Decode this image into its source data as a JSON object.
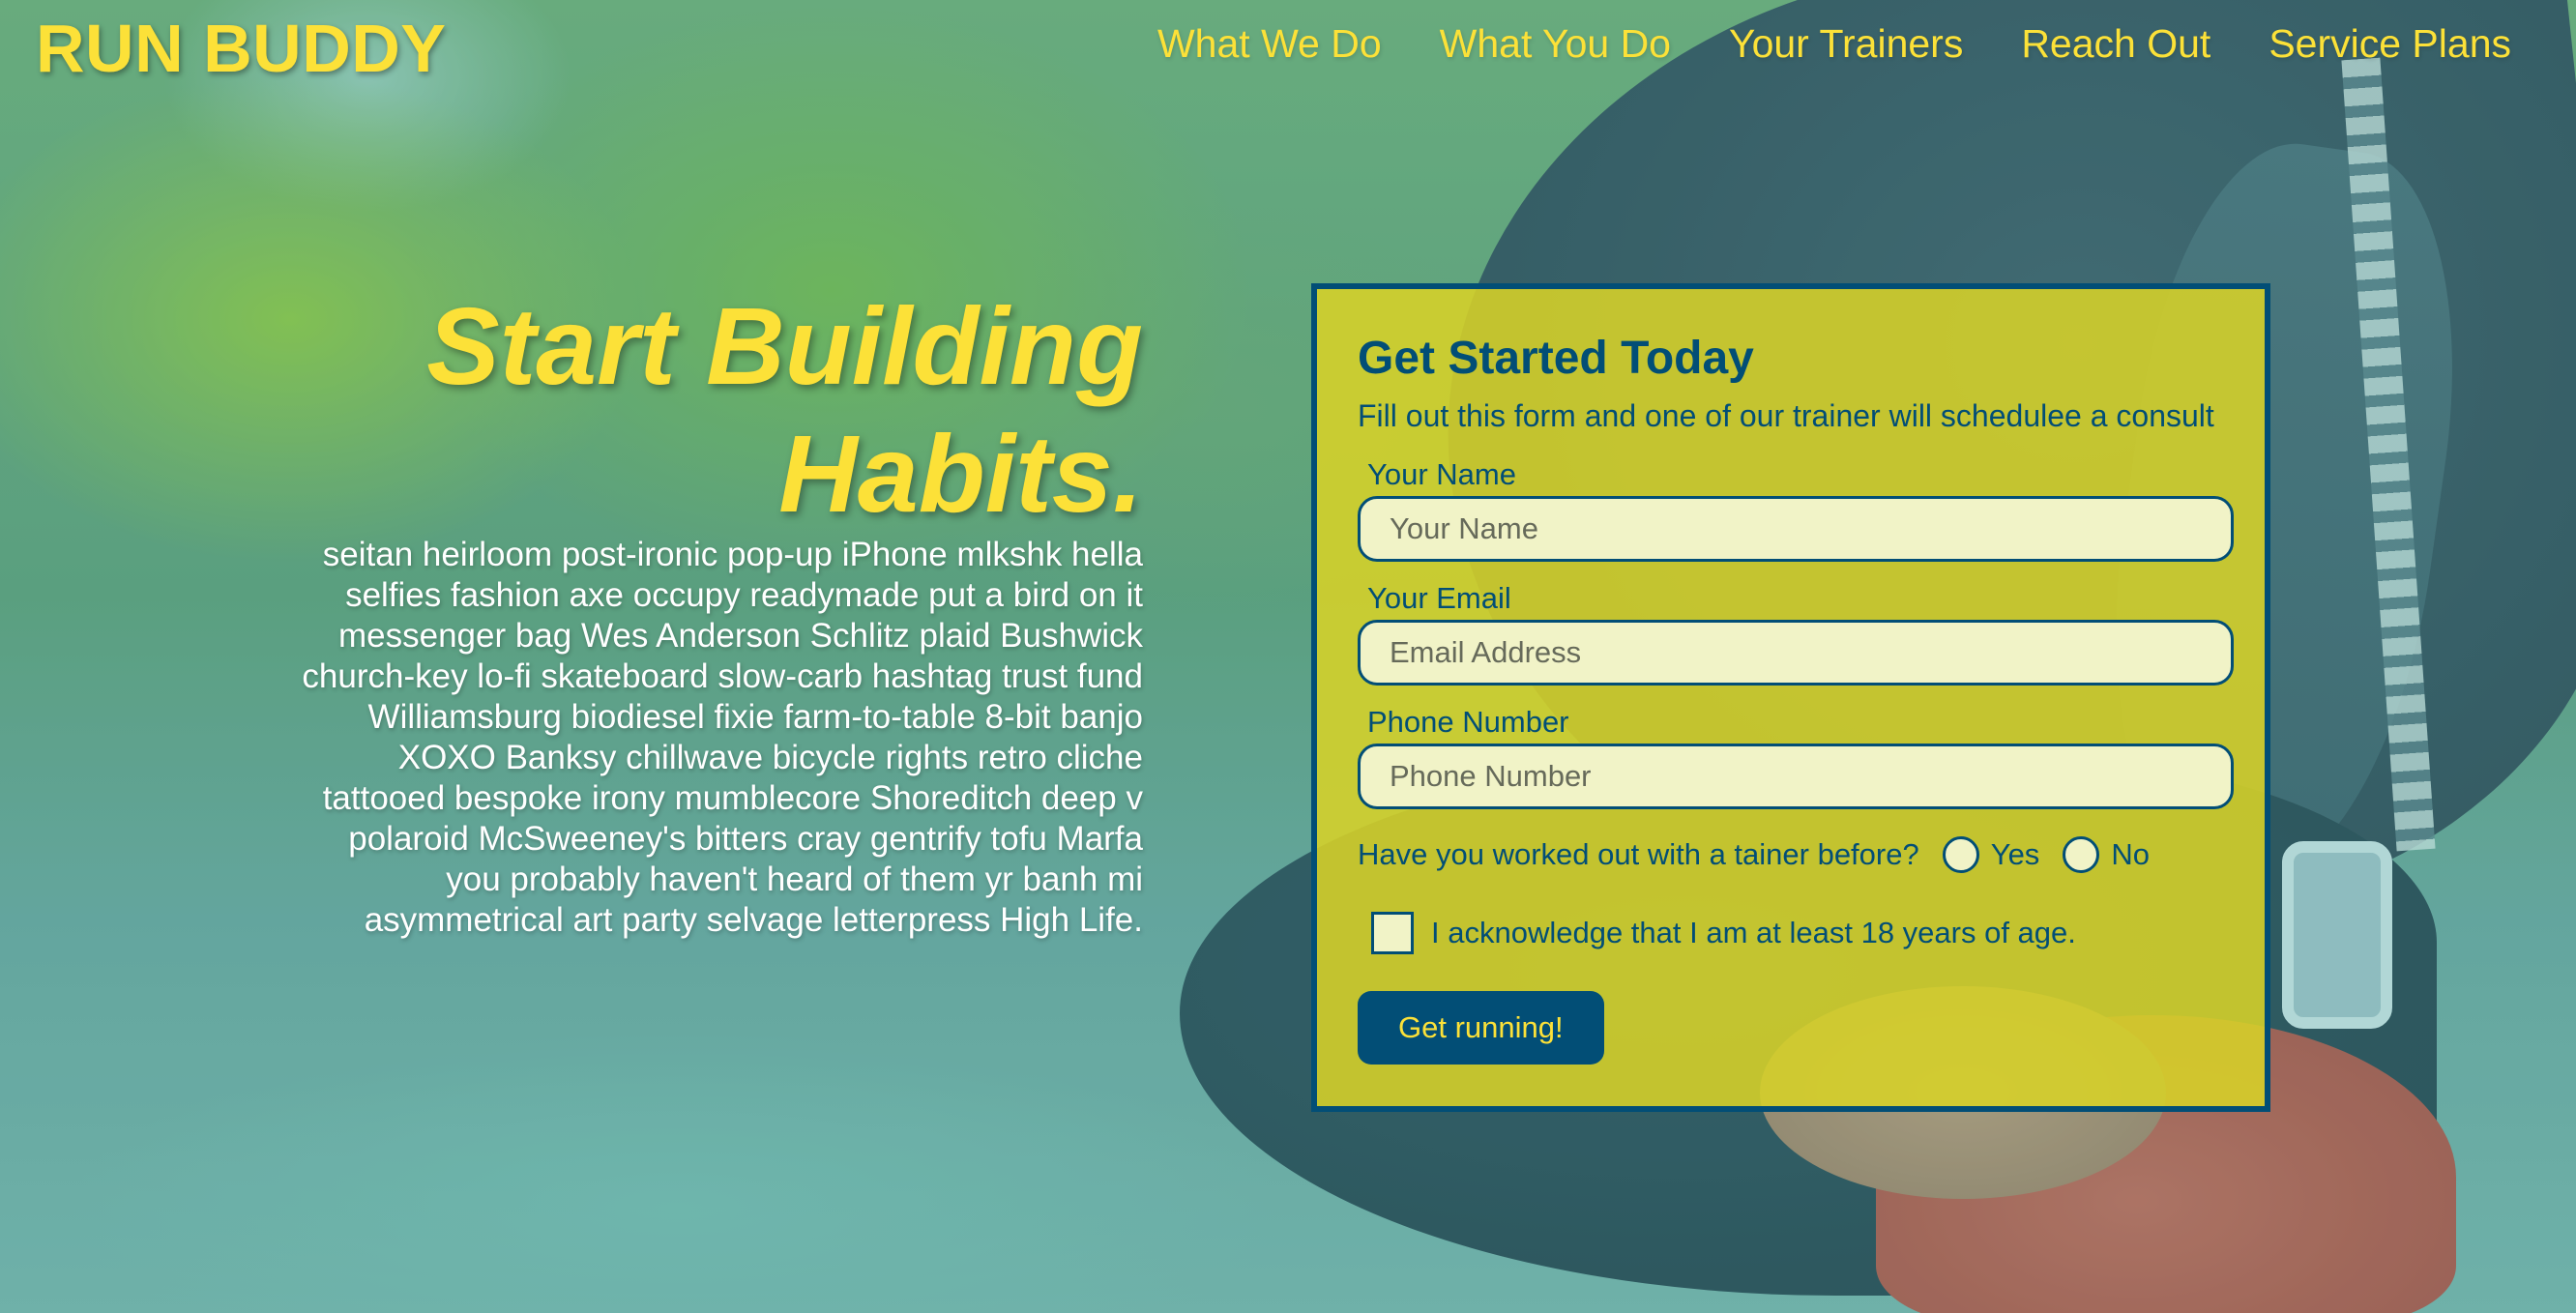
{
  "brand": {
    "name": "RUN BUDDY"
  },
  "nav": {
    "items": [
      {
        "label": "What We Do"
      },
      {
        "label": "What You Do"
      },
      {
        "label": "Your Trainers"
      },
      {
        "label": "Reach Out"
      },
      {
        "label": "Service Plans"
      }
    ]
  },
  "hero": {
    "title": "Start Building Habits.",
    "body": "seitan heirloom post-ironic pop-up iPhone mlkshk hella selfies fashion axe occupy readymade put a bird on it messenger bag Wes Anderson Schlitz plaid Bushwick church-key lo-fi skateboard slow-carb hashtag trust fund Williamsburg biodiesel fixie farm-to-table 8-bit banjo XOXO Banksy chillwave bicycle rights retro cliche tattooed bespoke irony mumblecore Shoreditch deep v polaroid McSweeney's bitters cray gentrify tofu Marfa you probably haven't heard of them yr banh mi asymmetrical art party selvage letterpress High Life."
  },
  "form": {
    "title": "Get Started Today",
    "subtitle": "Fill out this form and one of our trainer will schedulee a consult",
    "name": {
      "label": "Your Name",
      "placeholder": "Your Name",
      "value": ""
    },
    "email": {
      "label": "Your Email",
      "placeholder": "Email Address",
      "value": ""
    },
    "phone": {
      "label": "Phone Number",
      "placeholder": "Phone Number",
      "value": ""
    },
    "trainer_question": {
      "label": "Have you worked out with a tainer before?",
      "options": [
        {
          "label": "Yes"
        },
        {
          "label": "No"
        }
      ]
    },
    "age_ack": {
      "label": "I acknowledge that I am at least 18 years of age.",
      "checked": false
    },
    "submit_label": "Get running!"
  },
  "colors": {
    "brand_yellow": "#fce138",
    "brand_blue": "#024e76",
    "form_background": "#d7d228",
    "input_background": "#f1f3c7"
  },
  "icons": {}
}
